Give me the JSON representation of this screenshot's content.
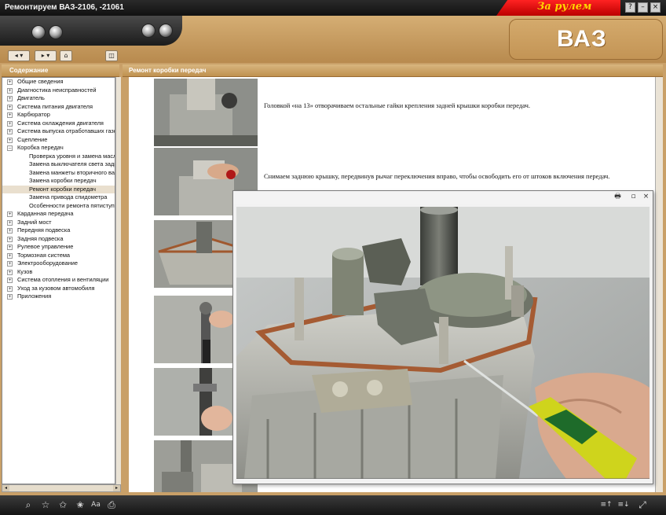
{
  "window": {
    "title": "Ремонтируем ВАЗ-2106, -21061",
    "brand": "За рулем",
    "controls": [
      "?",
      "–",
      "×"
    ]
  },
  "header": {
    "logo_text": "ВАЗ"
  },
  "toolbar": {
    "back": "◂ ▾",
    "forward": "▸ ▾",
    "home": "⌂",
    "pane_toggle": "◫"
  },
  "toc": {
    "title": "Содержание",
    "items": [
      {
        "label": "Общие сведения",
        "expander": "+",
        "level": 0
      },
      {
        "label": "Диагностика неисправностей",
        "expander": "+",
        "level": 0
      },
      {
        "label": "Двигатель",
        "expander": "+",
        "level": 0
      },
      {
        "label": "Система питания двигателя",
        "expander": "+",
        "level": 0
      },
      {
        "label": "Карбюратор",
        "expander": "+",
        "level": 0
      },
      {
        "label": "Система охлаждения двигателя",
        "expander": "+",
        "level": 0
      },
      {
        "label": "Система выпуска отработавших газо",
        "expander": "+",
        "level": 0
      },
      {
        "label": "Сцепление",
        "expander": "+",
        "level": 0
      },
      {
        "label": "Коробка передач",
        "expander": "–",
        "level": 0
      },
      {
        "label": "Проверка уровня и замена масла",
        "level": 1
      },
      {
        "label": "Замена выключателя света задн",
        "level": 1
      },
      {
        "label": "Замена манжеты вторичного вал",
        "level": 1
      },
      {
        "label": "Замена коробки передач",
        "level": 1
      },
      {
        "label": "Ремонт коробки передач",
        "level": 1,
        "selected": true
      },
      {
        "label": "Замена привода спидометра",
        "level": 1
      },
      {
        "label": "Особенности ремонта пятиступен",
        "level": 1
      },
      {
        "label": "Карданная передача",
        "expander": "+",
        "level": 0
      },
      {
        "label": "Задний мост",
        "expander": "+",
        "level": 0
      },
      {
        "label": "Передняя подвеска",
        "expander": "+",
        "level": 0
      },
      {
        "label": "Задняя подвеска",
        "expander": "+",
        "level": 0
      },
      {
        "label": "Рулевое управление",
        "expander": "+",
        "level": 0
      },
      {
        "label": "Тормозная система",
        "expander": "+",
        "level": 0
      },
      {
        "label": "Электрооборудование",
        "expander": "+",
        "level": 0
      },
      {
        "label": "Кузов",
        "expander": "+",
        "level": 0
      },
      {
        "label": "Система отопления и вентиляции",
        "expander": "+",
        "level": 0
      },
      {
        "label": "Уход за кузовом автомобиля",
        "expander": "+",
        "level": 0
      },
      {
        "label": "Приложения",
        "expander": "+",
        "level": 0
      }
    ]
  },
  "content": {
    "title": "Ремонт коробки передач",
    "paragraphs": [
      "Головкой «на 13» отворачиваем остальные гайки крепления задней крышки коробки передач.",
      "Снимаем заднюю крышку, передвинув рычаг переключения вправо, чтобы освободить его от штоков включения передач."
    ]
  },
  "popup": {
    "buttons": [
      "🖶",
      "▫",
      "×"
    ]
  },
  "bottom": {
    "left_icons": [
      "⌕",
      "☆",
      "✩",
      "✬",
      "Aa",
      "⎙"
    ],
    "right_icons": [
      "≡↑",
      "≡↓",
      "⤢"
    ]
  },
  "colors": {
    "accent": "#c39455",
    "brand_red": "#e00000",
    "brand_yellow": "#ffd400"
  }
}
